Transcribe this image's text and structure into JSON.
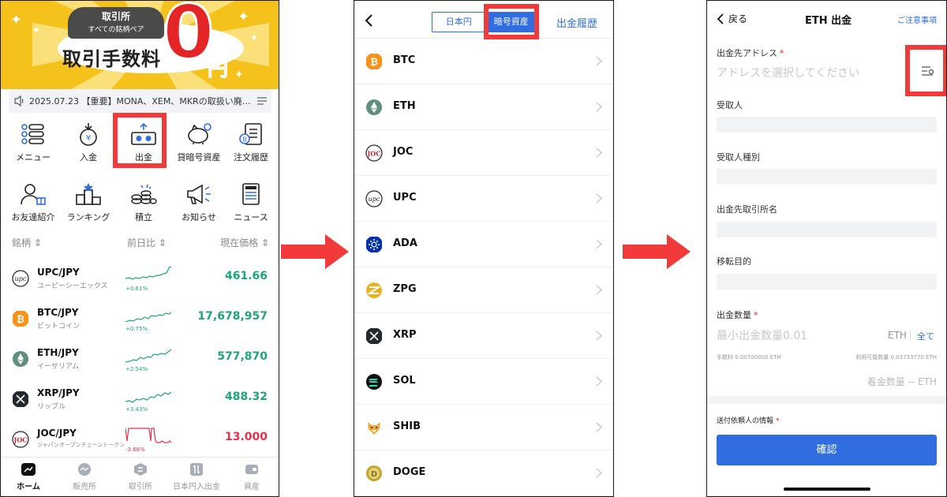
{
  "colors": {
    "highlight": "#f23a3a",
    "primary": "#2f6de1",
    "up": "#1ea57a",
    "down": "#e0314b",
    "banner": "#f4c21a"
  },
  "screen1": {
    "banner": {
      "pill_line1": "取引所",
      "pill_line2": "すべての銘柄ペア",
      "fee_text": "取引手数料",
      "zero": "0",
      "yen": "円"
    },
    "news": {
      "icon": "speaker-icon",
      "text": "2025.07.23 【重要】MONA、XEM、MKRの取扱い廃…"
    },
    "menu": [
      {
        "label": "メニュー",
        "icon": "menu-list-icon"
      },
      {
        "label": "入金",
        "icon": "deposit-icon"
      },
      {
        "label": "出金",
        "icon": "withdraw-icon"
      },
      {
        "label": "貸暗号資産",
        "icon": "piggy-bank-icon"
      },
      {
        "label": "注文履歴",
        "icon": "order-history-icon"
      },
      {
        "label": "お友達紹介",
        "icon": "invite-friends-icon"
      },
      {
        "label": "ランキング",
        "icon": "ranking-icon"
      },
      {
        "label": "積立",
        "icon": "savings-icon"
      },
      {
        "label": "お知らせ",
        "icon": "megaphone-icon"
      },
      {
        "label": "ニュース",
        "icon": "news-icon"
      }
    ],
    "market_header": {
      "col1": "銘柄 ⇕",
      "col2": "前日比 ⇕",
      "col3": "現在価格 ⇕"
    },
    "market": [
      {
        "pair": "UPC/JPY",
        "name": "ユーピーシーエックス",
        "change": "+0.61%",
        "price": "461.66",
        "trend": "up",
        "coin_color": "#ffffff",
        "icon": "upc-coin-icon"
      },
      {
        "pair": "BTC/JPY",
        "name": "ビットコイン",
        "change": "+0.75%",
        "price": "17,678,957",
        "trend": "up",
        "coin_color": "#f7931a",
        "icon": "btc-coin-icon"
      },
      {
        "pair": "ETH/JPY",
        "name": "イーサリアム",
        "change": "+2.54%",
        "price": "577,870",
        "trend": "up",
        "coin_color": "#5f8f7a",
        "icon": "eth-coin-icon"
      },
      {
        "pair": "XRP/JPY",
        "name": "リップル",
        "change": "+3.43%",
        "price": "488.32",
        "trend": "up",
        "coin_color": "#23292f",
        "icon": "xrp-coin-icon"
      },
      {
        "pair": "JOC/JPY",
        "name": "ジャパンオープンチェーントークン",
        "change": "-3.68%",
        "price": "13.000",
        "trend": "down",
        "coin_color": "#ffffff",
        "icon": "joc-coin-icon"
      }
    ],
    "tabs": [
      {
        "label": "ホーム",
        "active": true,
        "icon": "home-icon"
      },
      {
        "label": "販売所",
        "active": false,
        "icon": "exchange-icon"
      },
      {
        "label": "取引所",
        "active": false,
        "icon": "trade-icon"
      },
      {
        "label": "日本円入出金",
        "active": false,
        "icon": "yen-transfer-icon"
      },
      {
        "label": "資産",
        "active": false,
        "icon": "wallet-icon"
      }
    ]
  },
  "screen2": {
    "segments": {
      "jpy": "日本円",
      "crypto": "暗号資産"
    },
    "history": "出金履歴",
    "assets": [
      {
        "name": "BTC",
        "color": "#f7931a",
        "icon": "btc-coin-icon"
      },
      {
        "name": "ETH",
        "color": "#5f8f7a",
        "icon": "eth-coin-icon"
      },
      {
        "name": "JOC",
        "color": "#ffffff",
        "icon": "joc-coin-icon"
      },
      {
        "name": "UPC",
        "color": "#ffffff",
        "icon": "upc-coin-icon"
      },
      {
        "name": "ADA",
        "color": "#0033ad",
        "icon": "ada-coin-icon"
      },
      {
        "name": "ZPG",
        "color": "#e7b324",
        "icon": "zpg-coin-icon"
      },
      {
        "name": "XRP",
        "color": "#23292f",
        "icon": "xrp-coin-icon"
      },
      {
        "name": "SOL",
        "color": "#111111",
        "icon": "sol-coin-icon"
      },
      {
        "name": "SHIB",
        "color": "#f2a93b",
        "icon": "shib-coin-icon"
      },
      {
        "name": "DOGE",
        "color": "#c2a633",
        "icon": "doge-coin-icon"
      }
    ]
  },
  "screen3": {
    "back": "戻る",
    "title": "ETH 出金",
    "notes": "ご注意事項",
    "address_label": "出金先アドレス",
    "address_placeholder": "アドレスを選択してください",
    "receiver_label": "受取人",
    "receiver_type_label": "受取人種別",
    "exchange_label": "出金先取引所名",
    "purpose_label": "移転目的",
    "amount_label": "出金数量",
    "amount_placeholder": "最小出金数量0.01",
    "amount_unit": "ETH",
    "all_button": "全て",
    "fee_text": "手数料 0.00700000 ETH",
    "available_text": "利用可能数量 0.03733770 ETH",
    "received_text": "着金数量 -- ETH",
    "sender_label": "送付依頼人の情報",
    "confirm": "確認"
  }
}
